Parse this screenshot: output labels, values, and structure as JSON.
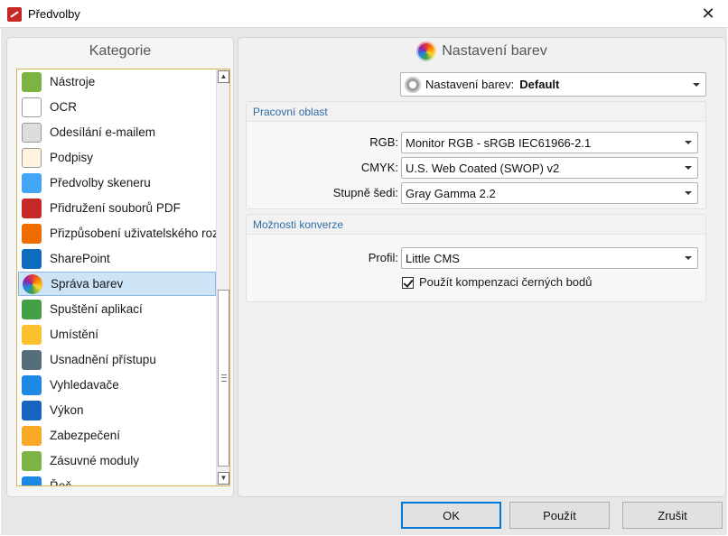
{
  "window": {
    "title": "Předvolby",
    "close_glyph": "✕"
  },
  "left_panel": {
    "title": "Kategorie",
    "items": [
      {
        "label": "Nástroje",
        "icon": "tools-icon",
        "color": "#7cb342"
      },
      {
        "label": "OCR",
        "icon": "ocr-icon",
        "color": "#ffffff"
      },
      {
        "label": "Odesílání e-mailem",
        "icon": "envelope-icon",
        "color": "#dddddd"
      },
      {
        "label": "Podpisy",
        "icon": "signature-icon",
        "color": "#fff3e0"
      },
      {
        "label": "Předvolby skeneru",
        "icon": "scanner-icon",
        "color": "#42a5f5"
      },
      {
        "label": "Přidružení souborů PDF",
        "icon": "pdf-file-icon",
        "color": "#c62828"
      },
      {
        "label": "Přizpůsobení uživatelského roz",
        "icon": "customize-icon",
        "color": "#ef6c00"
      },
      {
        "label": "SharePoint",
        "icon": "sharepoint-icon",
        "color": "#0f6cbd"
      },
      {
        "label": "Správa barev",
        "icon": "color-wheel-icon",
        "color": "#e53935",
        "selected": true
      },
      {
        "label": "Spuštění aplikací",
        "icon": "app-launch-icon",
        "color": "#43a047"
      },
      {
        "label": "Umístění",
        "icon": "folder-location-icon",
        "color": "#fbc02d"
      },
      {
        "label": "Usnadnění přístupu",
        "icon": "glasses-icon",
        "color": "#546e7a"
      },
      {
        "label": "Vyhledavače",
        "icon": "compass-icon",
        "color": "#1e88e5"
      },
      {
        "label": "Výkon",
        "icon": "gauge-icon",
        "color": "#1565c0"
      },
      {
        "label": "Zabezpečení",
        "icon": "shield-icon",
        "color": "#f9a825"
      },
      {
        "label": "Zásuvné moduly",
        "icon": "puzzle-icon",
        "color": "#7cb342"
      },
      {
        "label": "Řeč",
        "icon": "speech-icon",
        "color": "#1e88e5"
      }
    ]
  },
  "right_panel": {
    "title": "Nastavení barev",
    "preset": {
      "label": "Nastavení barev:",
      "value": "Default"
    },
    "workspace": {
      "title": "Pracovní oblast",
      "rgb": {
        "label": "RGB:",
        "value": "Monitor RGB - sRGB IEC61966-2.1"
      },
      "cmyk": {
        "label": "CMYK:",
        "value": "U.S. Web Coated (SWOP) v2"
      },
      "gray": {
        "label": "Stupně šedi:",
        "value": "Gray Gamma 2.2"
      }
    },
    "conversion": {
      "title": "Možnosti konverze",
      "profile": {
        "label": "Profil:",
        "value": "Little CMS"
      },
      "black_point": {
        "label": "Použít kompenzaci černých bodů",
        "checked": true
      }
    }
  },
  "buttons": {
    "ok": "OK",
    "apply": "Použít",
    "cancel": "Zrušit"
  }
}
